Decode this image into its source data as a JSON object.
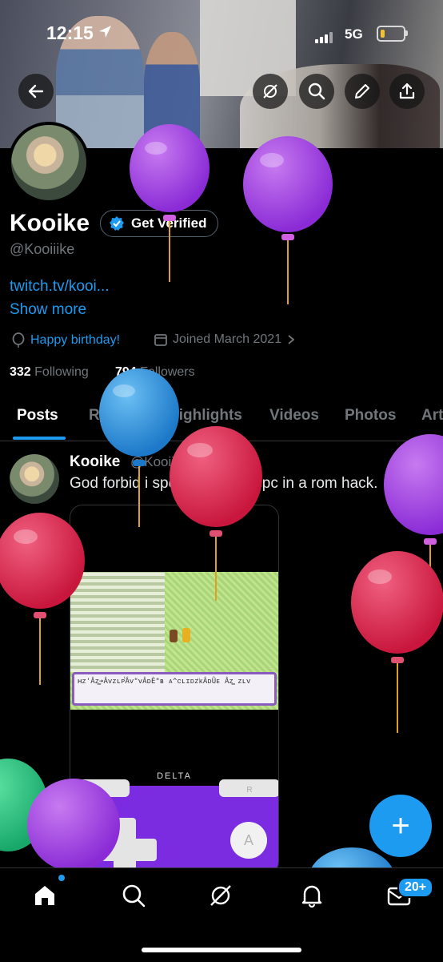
{
  "status_bar": {
    "time": "12:15",
    "network": "5G"
  },
  "profile": {
    "name": "Kooike",
    "verify_label": "Get Verified",
    "handle": "@Kooiiike",
    "link": "twitch.tv/kooi...",
    "show_more": "Show more",
    "birthday": "Happy birthday!",
    "joined": "Joined March 2021",
    "following_count": "332",
    "following_label": "Following",
    "followers_count": "794",
    "followers_label": "Followers"
  },
  "tabs": [
    "Posts",
    "Replies",
    "Highlights",
    "Videos",
    "Photos",
    "Art"
  ],
  "post": {
    "name": "Kooike",
    "handle_time": "@Kooiiike · 1d",
    "text": "God forbid i speak to ONE Npc in a rom hack.",
    "game_text": "ʜᴢ'Âᴢ͇͇➔Âᴠᴢʟᴘ̈́Âᴠ\"ᴠÂᴅÈ\"ʙ ᴀ^ᴄʟɪᴅᴢ̈ᴋÂᴅÛᴇ Âᴢ͇͇ ᴢʟᴠ",
    "device_label": "DELTA",
    "button_a": "A",
    "button_r": "R"
  },
  "fab_label": "+",
  "nav": {
    "badge": "20+"
  },
  "colors": {
    "accent": "#1d9bf0",
    "background": "#000000",
    "muted": "#71767b"
  }
}
